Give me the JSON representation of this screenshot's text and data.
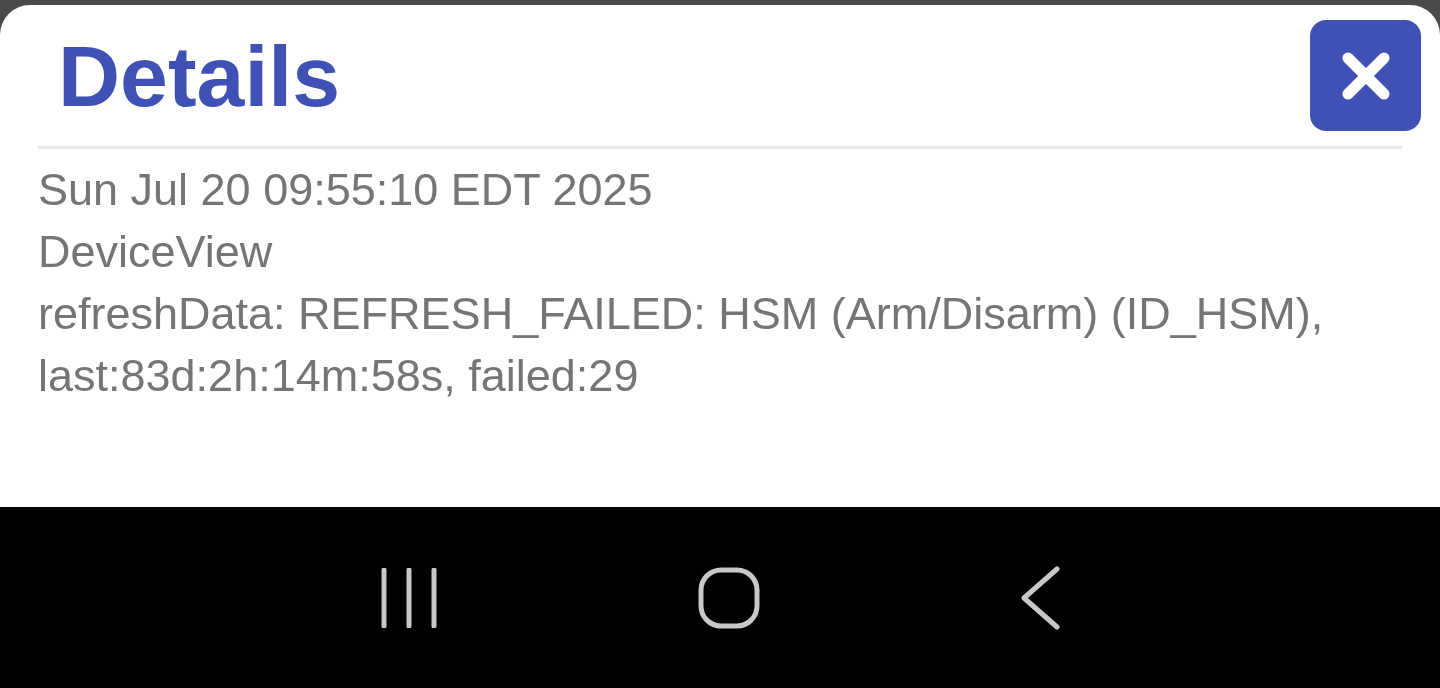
{
  "dialog": {
    "title": "Details",
    "lines": [
      "Sun Jul 20 09:55:10 EDT 2025",
      "DeviceView",
      "refreshData: REFRESH_FAILED: HSM (Arm/Disarm) (ID_HSM), last:83d:2h:14m:58s, failed:29"
    ]
  }
}
